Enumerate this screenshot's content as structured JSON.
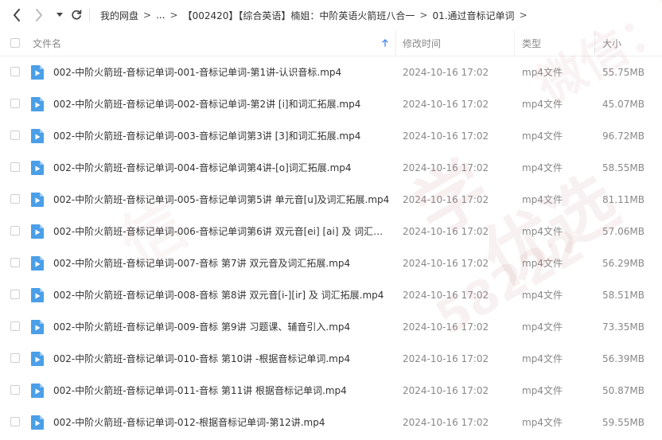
{
  "toolbar": {
    "back_icon": "chevron-left-icon",
    "forward_icon": "chevron-right-icon",
    "history_icon": "caret-down-icon",
    "refresh_icon": "refresh-icon",
    "breadcrumbs": [
      "我的网盘",
      "...",
      "【002420】【综合英语】楠姐：中阶英语火箭班八合一",
      "01.通过音标记单词"
    ]
  },
  "header": {
    "name_label": "文件名",
    "sort_icon": "arrow-up-icon",
    "date_label": "修改时间",
    "type_label": "类型",
    "size_label": "大小"
  },
  "files": [
    {
      "name": "002-中阶火箭班-音标记单词-001-音标记单词-第1讲-认识音标.mp4",
      "date": "2024-10-16 17:02",
      "type": "mp4文件",
      "size": "55.75MB"
    },
    {
      "name": "002-中阶火箭班-音标记单词-002-音标记单词-第2讲  [i]和词汇拓展.mp4",
      "date": "2024-10-16 17:02",
      "type": "mp4文件",
      "size": "45.07MB"
    },
    {
      "name": "002-中阶火箭班-音标记单词-003-音标记单词第3讲 [3]和词汇拓展.mp4",
      "date": "2024-10-16 17:02",
      "type": "mp4文件",
      "size": "96.72MB"
    },
    {
      "name": "002-中阶火箭班-音标记单词-004-音标记单词第4讲-[o]词汇拓展.mp4",
      "date": "2024-10-16 17:02",
      "type": "mp4文件",
      "size": "58.55MB"
    },
    {
      "name": "002-中阶火箭班-音标记单词-005-音标记单词第5讲 单元音[u]及词汇拓展.mp4",
      "date": "2024-10-16 17:02",
      "type": "mp4文件",
      "size": "81.11MB"
    },
    {
      "name": "002-中阶火箭班-音标记单词-006-音标记单词第6讲 双元音[ei] [ai] 及 词汇拓...",
      "date": "2024-10-16 17:02",
      "type": "mp4文件",
      "size": "57.06MB"
    },
    {
      "name": "002-中阶火箭班-音标记单词-007-音标 第7讲 双元音及词汇拓展.mp4",
      "date": "2024-10-16 17:02",
      "type": "mp4文件",
      "size": "56.29MB"
    },
    {
      "name": "002-中阶火箭班-音标记单词-008-音标 第8讲 双元音[i-][ir] 及 词汇拓展.mp4",
      "date": "2024-10-16 17:02",
      "type": "mp4文件",
      "size": "58.51MB"
    },
    {
      "name": "002-中阶火箭班-音标记单词-009-音标 第9讲 习题课、辅音引入.mp4",
      "date": "2024-10-16 17:02",
      "type": "mp4文件",
      "size": "73.35MB"
    },
    {
      "name": "002-中阶火箭班-音标记单词-010-音标 第10讲 -根据音标记单词.mp4",
      "date": "2024-10-16 17:02",
      "type": "mp4文件",
      "size": "56.39MB"
    },
    {
      "name": "002-中阶火箭班-音标记单词-011-音标 第11讲 根据音标记单词.mp4",
      "date": "2024-10-16 17:02",
      "type": "mp4文件",
      "size": "50.87MB"
    },
    {
      "name": "002-中阶火箭班-音标记单词-012-根据音标记单词-第12讲.mp4",
      "date": "2024-10-16 17:02",
      "type": "mp4文件",
      "size": "59.55MB"
    }
  ],
  "file_icon": "video-file-icon",
  "colors": {
    "file_icon": "#4a9fe8",
    "text": "#333333",
    "muted": "#888888",
    "accent": "#4a8df0",
    "watermark": "#c98a8a"
  },
  "watermark": {
    "lines": [
      "学",
      "信",
      "微信：58",
      "优选",
      "58222"
    ]
  }
}
